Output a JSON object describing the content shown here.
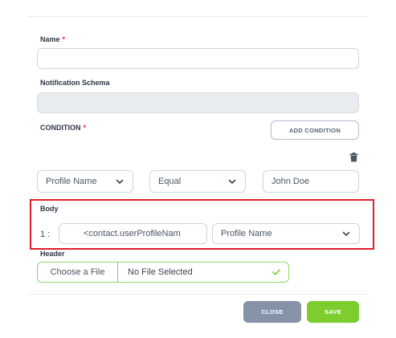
{
  "form": {
    "name": {
      "label": "Name",
      "required_mark": "*",
      "value": ""
    },
    "notification_schema": {
      "label": "Notification Schema",
      "value": ""
    },
    "condition": {
      "label": "CONDITION",
      "required_mark": "*",
      "add_button": "ADD CONDITION",
      "field_select": "Profile Name",
      "operator_select": "Equal",
      "value": "John Doe"
    },
    "body": {
      "label": "Body",
      "row_index": "1 :",
      "token_value": "<contact.userProfileNam",
      "mapping_select": "Profile Name"
    },
    "header": {
      "label": "Header",
      "choose_file_button": "Choose a File",
      "file_status": "No File Selected"
    }
  },
  "footer": {
    "close_label": "CLOSE",
    "save_label": "SAVE"
  },
  "colors": {
    "required": "#e0242e",
    "highlight": "#e01f2a",
    "save": "#7dcd2f",
    "close": "#8593a8",
    "file_border": "#8fd36b"
  },
  "icons": [
    "trash-icon",
    "chevron-down-icon",
    "check-icon"
  ]
}
